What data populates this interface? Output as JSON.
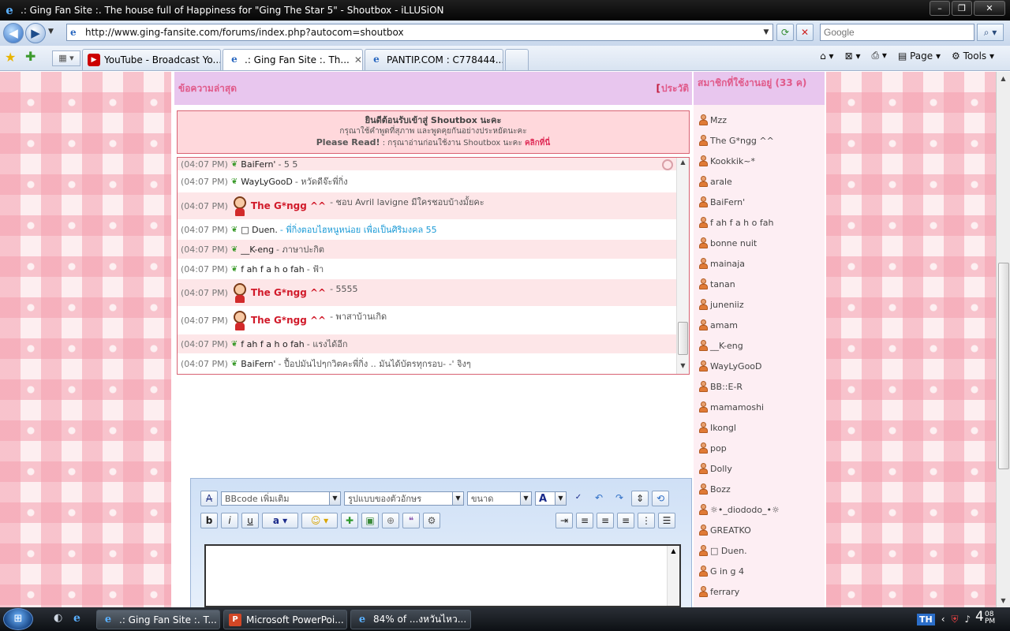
{
  "window": {
    "title": ".: Ging Fan Site :. The house full of Happiness for \"Ging The Star 5\" - Shoutbox - iLLUSiON"
  },
  "address_bar": {
    "url": "http://www.ging-fansite.com/forums/index.php?autocom=shoutbox",
    "search_placeholder": "Google"
  },
  "tabs": [
    {
      "label": "YouTube - Broadcast Yo...",
      "icon": "youtube-icon",
      "active": false
    },
    {
      "label": ".: Ging Fan Site :. Th...",
      "icon": "ie-page-icon",
      "active": true
    },
    {
      "label": "PANTIP.COM : C778444...",
      "icon": "ie-page-icon",
      "active": false
    }
  ],
  "command_bar": {
    "page_label": "Page",
    "tools_label": "Tools"
  },
  "shoutbox": {
    "header_title": "ข้อความล่าสุด",
    "history_link": "ประวัติ",
    "welcome_title": "ยินดีต้อนรับเข้าสู่ Shoutbox นะคะ",
    "welcome_line2": "กรุณาใช้คำพูดที่สุภาพ และพูดคุยกันอย่างประหยัดนะคะ",
    "please_read": "Please Read!",
    "welcome_line3": ": กรุณาอ่านก่อนใช้งาน Shoutbox นะคะ",
    "click_here": "คลิกที่นี่",
    "messages": [
      {
        "time": "(04:07 PM)",
        "user": "BaiFern'",
        "text": "- 5 5",
        "style": "normal"
      },
      {
        "time": "(04:07 PM)",
        "user": "WayLyGooD",
        "text": "- หวัดดีจ๊ะพี่กิ่ง",
        "style": "normal"
      },
      {
        "time": "(04:07 PM)",
        "user": "The G*ngg ^^",
        "text": "- ชอบ Avril lavigne มีใครชอบบ้างมั้ยคะ",
        "style": "admin"
      },
      {
        "time": "(04:07 PM)",
        "user": "□ Duen.",
        "text": "- พี่กิ่งตอบไฮหนูหน่อย เพื่อเป็นศิริมงคล 55",
        "style": "blue"
      },
      {
        "time": "(04:07 PM)",
        "user": "__K-eng",
        "text": "- ภาษาปะกิต",
        "style": "normal"
      },
      {
        "time": "(04:07 PM)",
        "user": "f ah f a h o fah",
        "text": "- ฟ้า",
        "style": "normal"
      },
      {
        "time": "(04:07 PM)",
        "user": "The G*ngg ^^",
        "text": "- 5555",
        "style": "admin"
      },
      {
        "time": "(04:07 PM)",
        "user": "The G*ngg ^^",
        "text": "- พาสาบ้านเกิด",
        "style": "admin"
      },
      {
        "time": "(04:07 PM)",
        "user": "f ah f a h o fah",
        "text": "- แรงได้อีก",
        "style": "normal"
      },
      {
        "time": "(04:07 PM)",
        "user": "BaiFern'",
        "text": "- ปื้อปมันไปๆกวิตคะพี่กิ่ง .. มันได้บัตรทุกรอบ- -' จิงๆ",
        "style": "normal"
      }
    ]
  },
  "editor": {
    "bbcode_select": "BBcode เพิ่มเติม",
    "font_select": "รูปแบบของตัวอักษร",
    "size_select": "ขนาด"
  },
  "online": {
    "header": "สมาชิกที่ใช้งานอยู่ (33 ค)",
    "users": [
      "Mzz",
      "The G*ngg ^^",
      "Kookkik~*",
      "arale",
      "BaiFern'",
      "f ah f a h o fah",
      "bonne nuit",
      "mainaja",
      "tanan",
      "juneniiz",
      "amam",
      "__K-eng",
      "WayLyGooD",
      "BB::E-R",
      "mamamoshi",
      "Ikongl",
      "pop",
      "Dolly",
      "Bozz",
      "☼•_diododo_•☼",
      "GREATKO",
      "□ Duen.",
      "G in g 4",
      "ferrary"
    ]
  },
  "taskbar": {
    "buttons": [
      {
        "label": ".: Ging Fan Site :. T...",
        "icon": "ie-icon",
        "active": true
      },
      {
        "label": "Microsoft PowerPoi...",
        "icon": "powerpoint-icon",
        "active": false
      },
      {
        "label": "84% of ...งหวันไหว...",
        "icon": "ie-icon",
        "active": false
      }
    ],
    "language": "TH",
    "clock_hour": "4",
    "clock_minute": "08",
    "clock_ampm": "PM"
  }
}
